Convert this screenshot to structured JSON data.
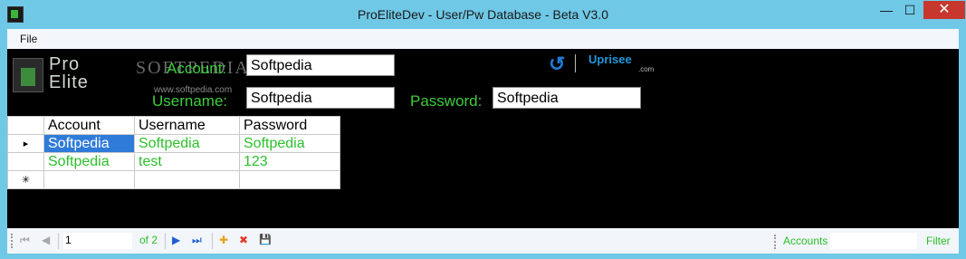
{
  "window": {
    "title": "ProEliteDev - User/Pw Database - Beta V3.0",
    "min_glyph": "—",
    "max_glyph": "☐",
    "close_glyph": "✕"
  },
  "menu": {
    "file": "File"
  },
  "logo": {
    "line1": "Pro",
    "line2": "Elite"
  },
  "watermark": {
    "text": "SOFTPEDIA",
    "url": "www.softpedia.com"
  },
  "form": {
    "account_label": "Account:",
    "account_value": "Softpedia",
    "username_label": "Username:",
    "username_value": "Softpedia",
    "password_label": "Password:",
    "password_value": "Softpedia"
  },
  "brand": {
    "arrow": "↺",
    "name": "Uprisee",
    "suffix": ".com"
  },
  "grid": {
    "headers": [
      "Account",
      "Username",
      "Password"
    ],
    "rows": [
      {
        "indicator": "▸",
        "account": "Softpedia",
        "username": "Softpedia",
        "password": "Softpedia"
      },
      {
        "indicator": "",
        "account": "Softpedia",
        "username": "test",
        "password": "123"
      }
    ],
    "new_row_indicator": "✳"
  },
  "navigator": {
    "first": "⏮",
    "prev": "◀",
    "position": "1",
    "of_text": "of 2",
    "next": "▶",
    "last": "⏭",
    "add": "✚",
    "delete": "✖",
    "save": "💾"
  },
  "filter": {
    "account_label": "Accounts",
    "filter_label": "Filter"
  },
  "colors": {
    "title_bar": "#6fc8e6",
    "accent_green": "#3ecc3e",
    "selection_blue": "#2f7bd9",
    "close_red": "#c7372e"
  }
}
